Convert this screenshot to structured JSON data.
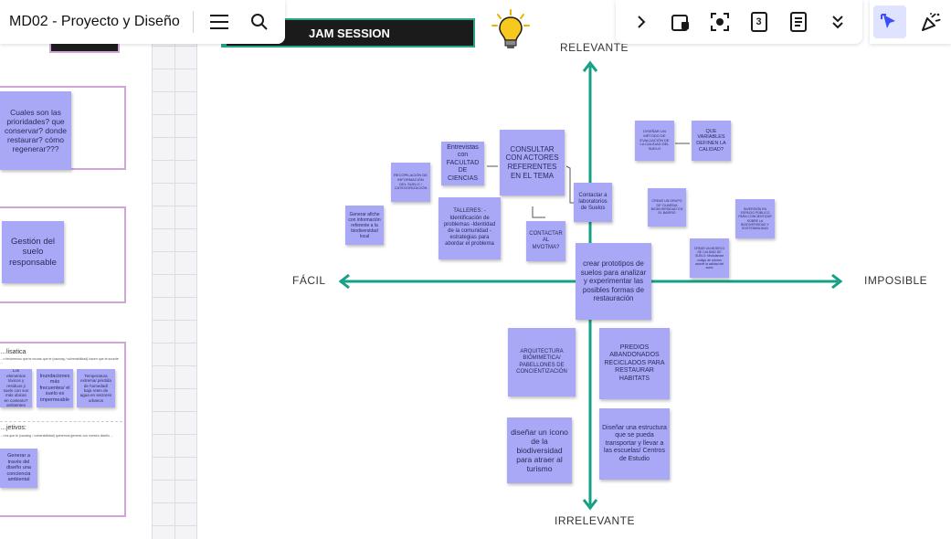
{
  "header": {
    "board_title": "MD02 - Proyecto y Diseño",
    "menu_icon": "hamburger-menu-icon",
    "search_icon": "search-icon"
  },
  "toolbar": {
    "expand_icon": "chevron-right-icon",
    "badge_number": "3",
    "icons": [
      "chevron-right-icon",
      "frame-icon",
      "focus-icon",
      "counter-icon",
      "notes-icon",
      "double-chevron-down-icon",
      "select-cursor-icon",
      "celebrate-icon"
    ],
    "active_color": "#dfe3ff"
  },
  "banner": {
    "title": "JAM SESSION"
  },
  "axes": {
    "top": "RELEVANTE",
    "bottom": "IRRELEVANTE",
    "left": "FÁCIL",
    "right": "IMPOSIBLE",
    "color": "#14a085"
  },
  "left_panel": {
    "note_priorities": "Cuales son las prioridades? que conservar? donde restaurar? cómo regenerar???",
    "note_gestion": "Gestión del suelo responsable",
    "section_heading_1": "…lisatica",
    "section_sub_1": "…n fenómenos que te cruzas que te (causing / vulnerabilidad) hacen que te sucede …",
    "tiny_note_1": "Los elementos tóxicos y residuos ji suelo con son más ubican en contexto? ambientes",
    "tiny_note_2": "Inundaciones más frecuentes/ el suelo es impermeable",
    "tiny_note_3": "Temperatura extrema/ pérdida de humedad/ baja reten de agua en sectores urbanos",
    "section_heading_2": "…jetivos:",
    "section_sub_2": "…ríos que te (causing / vulnerabilidad) queremos generar con nuestro diseño …",
    "tiny_note_4": "Generar a través del diseño una conciencia ambiental"
  },
  "notes": {
    "consultar": "CONSULTAR CON ACTORES REFERENTES EN EL TEMA",
    "entrevistas": "Entrevistas con FACULTAD DE CIENCIAS",
    "recopilacion": "RECOPILACIÓN DE INFORMACIÓN DEL SUELO / CATEGORIZACIÓN",
    "talleres": "TALLERES: -Identificación de problemas -Identidad de la comunidad -estrategias para abordar el problema",
    "contactar_lab": "Contactar a laboratorios de Suelos",
    "contactar_mvot": "CONTACTAR AL MVOTMA?",
    "afiche": "Generar afiche con información referente a la biodiversidad local",
    "disenar_metodo": "DISEÑAR UN MÉTODO DE EVALUACIÓN DE LA CALIDAD DEL SUELO",
    "variables": "QUE VARIABLES DEFINEN LA CALIDAD?",
    "crear_grupo": "CREAR UN GRUPO DE 'GUARDIA BIODIVERSIDAD' EN EL BARRIO",
    "invertir": "INVERSIÓN EN ESPACIO PÚBLICO PARA CONCIENTIZAR SOBRE LA BIODIVERSIDAD Y SOSTENIBILIDAD",
    "crear_modelo": "CREAR UN MODELO DE CALIDAD DE SUELO: Modularizar código de colores acorde la calidad del suelo",
    "prototipos": "crear prototipos de suelos para analizar y experimentar las posibles formas de restauración",
    "arquitectura": "ARQUITECTURA BIOMIMETICA/ PABELLONES DE CONCIENTIZACIÓN",
    "predios": "PREDIOS ABANDONADOS RECICLADOS PARA RESTAURAR HABITATS",
    "icono": "diseñar un ícono de la biodiversidad para atraer al turismo",
    "estructura": "Diseñar una estructura que se pueda transportar y llevar a las escuelas/ Centros de Estudio"
  },
  "colors": {
    "sticky": "#a9a8f7",
    "frame_border": "#cfa6d6",
    "banner_border": "#2aa58a"
  }
}
